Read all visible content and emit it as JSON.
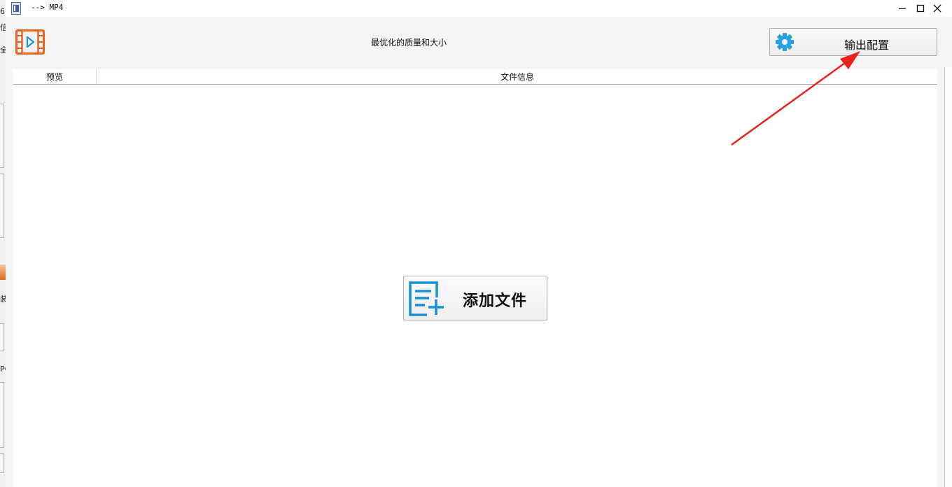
{
  "window": {
    "title": "--> MP4"
  },
  "left_strip": {
    "glyphs": [
      "6",
      "信",
      "全",
      "装",
      "PC"
    ]
  },
  "header": {
    "subtitle": "最优化的质量和大小",
    "output_button_label": "输出配置"
  },
  "table": {
    "columns": [
      "预览",
      "文件信息"
    ]
  },
  "main": {
    "add_file_label": "添加文件"
  },
  "colors": {
    "logo_orange": "#e8641c",
    "gear_blue": "#29a3e0",
    "add_icon_blue": "#1a8fd6",
    "arrow_red": "#e8231a"
  },
  "icons": {
    "title": "app-file-icon",
    "logo": "film-play-icon",
    "output": "gear-icon",
    "add": "add-file-icon"
  }
}
